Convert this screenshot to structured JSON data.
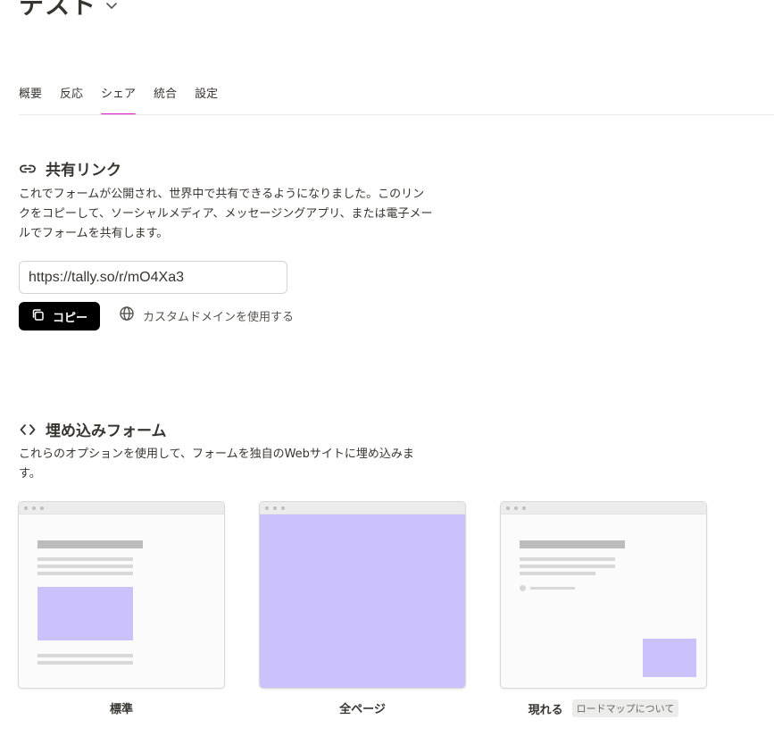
{
  "header": {
    "title": "テスト",
    "chevron_icon": "chevron-down-icon"
  },
  "tabs": [
    {
      "label": "概要"
    },
    {
      "label": "反応"
    },
    {
      "label": "シェア",
      "active": true
    },
    {
      "label": "統合"
    },
    {
      "label": "設定"
    }
  ],
  "share_link": {
    "icon": "link-icon",
    "title": "共有リンク",
    "description_lines": [
      "これでフォームが公開され、世界中で共有できるようになりました。このリン",
      "クをコピーして、ソーシャルメディア、メッセージングアプリ、または電子メー",
      "ルでフォームを共有します。"
    ],
    "url": "https://tally.so/r/mO4Xa3",
    "copy_label": "コピー",
    "copy_icon": "copy-icon",
    "custom_domain_label": "カスタムドメインを使用する",
    "custom_domain_icon": "globe-icon"
  },
  "embed": {
    "icon": "code-icon",
    "title": "埋め込みフォーム",
    "description_lines": [
      "これらのオプションを使用して、フォームを独自のWebサイトに埋め込みま",
      "す。"
    ],
    "options": [
      {
        "label": "標準"
      },
      {
        "label": "全ページ"
      },
      {
        "label": "現れる",
        "badge": "ロードマップについて"
      }
    ]
  },
  "colors": {
    "accent_tab": "#e010c8",
    "preview_purple": "#cbc2fb",
    "button_bg": "#000000"
  }
}
